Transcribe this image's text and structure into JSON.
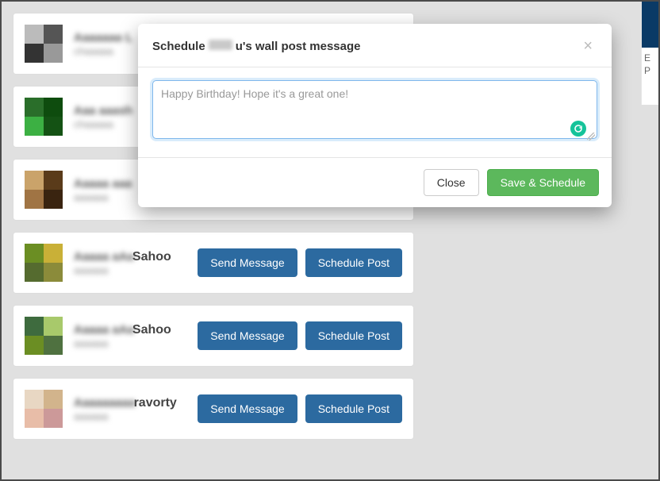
{
  "modal": {
    "title_prefix": "Schedule",
    "title_suffix": "u's wall post message",
    "placeholder": "Happy Birthday! Hope it's a great one!",
    "value": "",
    "close_label": "Close",
    "save_label": "Save & Schedule"
  },
  "buttons": {
    "send_message": "Send Message",
    "schedule_post": "Schedule Post"
  },
  "list": {
    "items": [
      {
        "name_blur": "Aaaaaaa L",
        "name_suffix": "",
        "sub_blur": "chaaaaa"
      },
      {
        "name_blur": "Aaa aaash",
        "name_suffix": "",
        "sub_blur": "chaaaaa"
      },
      {
        "name_blur": "Aaaaa aaa",
        "name_suffix": "",
        "sub_blur": "aaaaaa"
      },
      {
        "name_blur": "Aaaaa aAa",
        "name_suffix": "Sahoo",
        "sub_blur": "aaaaaa"
      },
      {
        "name_blur": "Aaaaa aAa",
        "name_suffix": "Sahoo",
        "sub_blur": "aaaaaa"
      },
      {
        "name_blur": "Aaaaaaaaa",
        "name_suffix": "ravorty",
        "sub_blur": "aaaaaa"
      }
    ]
  },
  "right_panel": {
    "line1": "E",
    "line2": "P"
  }
}
